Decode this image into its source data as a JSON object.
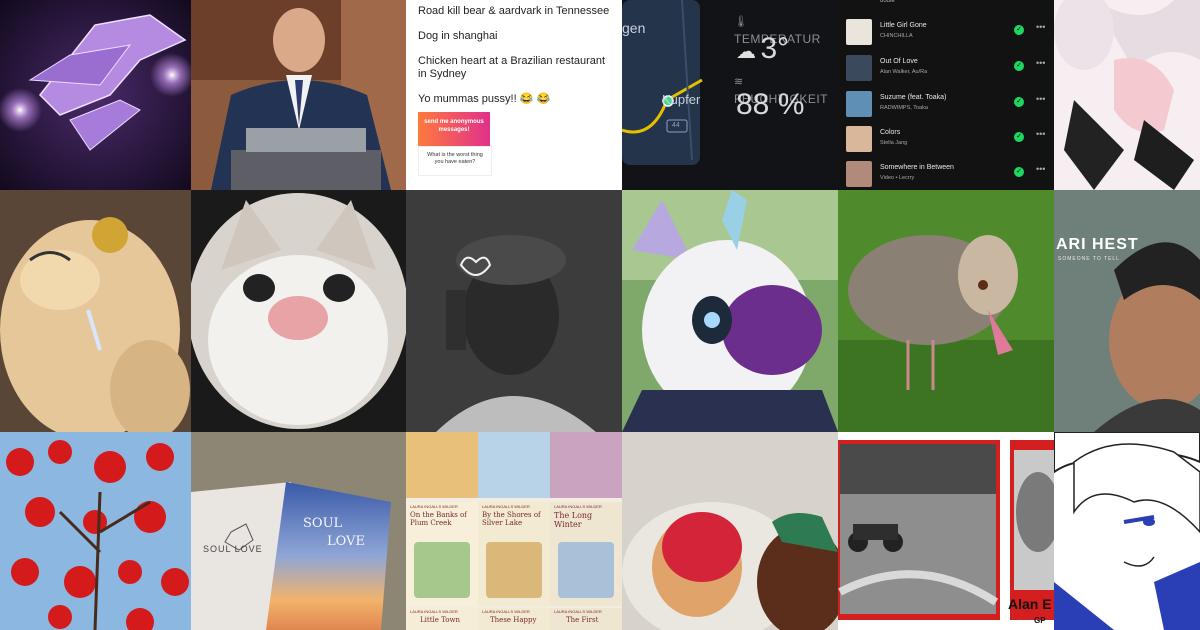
{
  "text_post": {
    "lines": [
      "Road kill bear & aardvark in Tennessee",
      "Dog in shanghai",
      "Chicken heart at a Brazilian restaurant in Sydney",
      "Yo mummas pussy!! 😂 😂"
    ],
    "card_title": "send me anonymous messages!",
    "card_question": "What is the worst thing you have eaten?"
  },
  "map": {
    "label_top": "gen",
    "label_mid": "Kupfer",
    "road": "44"
  },
  "weather": {
    "temp_label": "TEMPERATUR",
    "temp_value": "3°",
    "hum_label": "FEUCHTIGKEIT",
    "hum_value": "88 %"
  },
  "playlist": {
    "top_artist": "dodie",
    "tracks": [
      {
        "title": "Little Girl Gone",
        "artist": "CHINCHILLA",
        "color": "#e9e4dc"
      },
      {
        "title": "Out Of Love",
        "artist": "Alan Walker, Au/Ra",
        "color": "#3a4a5c"
      },
      {
        "title": "Suzume (feat. Toaka)",
        "artist": "RADWIMPS, Toaka",
        "color": "#5f8fb5"
      },
      {
        "title": "Colors",
        "artist": "Stella Jang",
        "color": "#d9b79a"
      },
      {
        "title": "Somewhere in Between",
        "artist": "Video • Lecrry",
        "color": "#b08a7a"
      }
    ]
  },
  "album": {
    "title": "ARI HEST",
    "subtitle": "SOMEONE TO TELL"
  },
  "books": [
    {
      "author": "LAURA INGALLS WILDER",
      "title": "On the Banks of Plum Creek"
    },
    {
      "author": "LAURA INGALLS WILDER",
      "title": "By the Shores of Silver Lake"
    },
    {
      "author": "LAURA INGALLS WILDER",
      "title": "The Long Winter"
    },
    {
      "author": "LAURA INGALLS WILDER",
      "title": "Little Town"
    },
    {
      "author": "LAURA INGALLS WILDER",
      "title": "These Happy"
    },
    {
      "author": "LAURA INGALLS WILDER",
      "title": "The First"
    }
  ],
  "soul_love": {
    "left": "SOUL LOVE",
    "right_1": "SOUL",
    "right_2": "LOVE"
  },
  "race_poster": {
    "name": "Alan E",
    "sub": "GP"
  },
  "colors": {
    "accent_green": "#1ed760",
    "map_route": "#e6c000",
    "map_dot": "#3ddc84"
  }
}
